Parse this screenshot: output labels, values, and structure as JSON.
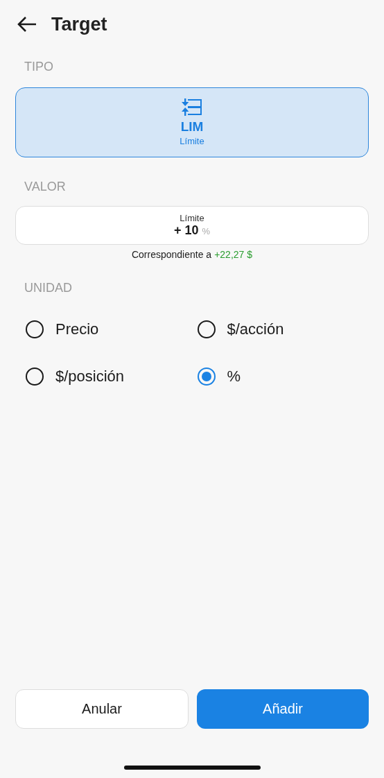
{
  "header": {
    "title": "Target"
  },
  "type_section": {
    "label": "TIPO",
    "card": {
      "code": "LIM",
      "name": "Límite",
      "selected": true
    }
  },
  "value_section": {
    "label": "VALOR",
    "field": {
      "label": "Límite",
      "value": "+ 10",
      "unit": "%"
    },
    "correspondence": {
      "text": "Correspondiente a",
      "amount": "+22,27 $"
    }
  },
  "unit_section": {
    "label": "UNIDAD",
    "options": [
      {
        "label": "Precio",
        "selected": false
      },
      {
        "label": "$/acción",
        "selected": false
      },
      {
        "label": "$/posición",
        "selected": false
      },
      {
        "label": "%",
        "selected": true
      }
    ]
  },
  "buttons": [
    {
      "label": "Anular",
      "kind": "secondary"
    },
    {
      "label": "Añadir",
      "kind": "primary"
    }
  ]
}
